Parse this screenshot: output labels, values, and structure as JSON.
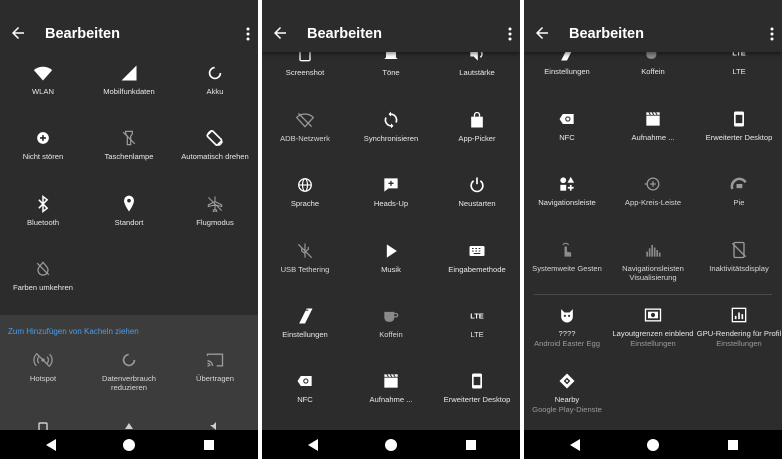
{
  "screens": [
    {
      "title": "Bearbeiten",
      "active_tiles": [
        {
          "label": "WLAN"
        },
        {
          "label": "Mobilfunkdaten"
        },
        {
          "label": "Akku"
        },
        {
          "label": "Nicht stören"
        },
        {
          "label": "Taschenlampe"
        },
        {
          "label": "Automatisch drehen"
        },
        {
          "label": "Bluetooth"
        },
        {
          "label": "Standort"
        },
        {
          "label": "Flugmodus"
        },
        {
          "label": "Farben umkehren"
        }
      ],
      "drag_hint": "Zum Hinzufügen von Kacheln ziehen",
      "available_tiles": [
        {
          "label": "Hotspot"
        },
        {
          "label": "Datenverbrauch",
          "label2": "reduzieren"
        },
        {
          "label": "Übertragen"
        }
      ]
    },
    {
      "title": "Bearbeiten",
      "tiles": [
        {
          "label": "Screenshot"
        },
        {
          "label": "Töne"
        },
        {
          "label": "Lautstärke"
        },
        {
          "label": "ADB-Netzwerk"
        },
        {
          "label": "Synchronisieren"
        },
        {
          "label": "App-Picker"
        },
        {
          "label": "Sprache"
        },
        {
          "label": "Heads-Up"
        },
        {
          "label": "Neustarten"
        },
        {
          "label": "USB Tethering"
        },
        {
          "label": "Musik"
        },
        {
          "label": "Eingabemethode"
        },
        {
          "label": "Einstellungen"
        },
        {
          "label": "Koffein"
        },
        {
          "label": "LTE"
        },
        {
          "label": "NFC"
        },
        {
          "label": "Aufnahme ..."
        },
        {
          "label": "Erweiterter Desktop"
        }
      ]
    },
    {
      "title": "Bearbeiten",
      "tiles": [
        {
          "label": "Einstellungen"
        },
        {
          "label": "Koffein"
        },
        {
          "label": "LTE"
        },
        {
          "label": "NFC"
        },
        {
          "label": "Aufnahme ..."
        },
        {
          "label": "Erweiterter Desktop"
        },
        {
          "label": "Navigationsleiste"
        },
        {
          "label": "App-Kreis-Leiste"
        },
        {
          "label": "Pie"
        },
        {
          "label": "Systemweite Gesten"
        },
        {
          "label": "Navigationsleisten",
          "label2": "Visualisierung"
        },
        {
          "label": "Inaktivitätsdisplay"
        },
        {
          "label": "????",
          "sub": "Android Easter Egg"
        },
        {
          "label": "Layoutgrenzen einblend",
          "sub": "Einstellungen"
        },
        {
          "label": "GPU-Rendering für Profil",
          "sub": "Einstellungen"
        },
        {
          "label": "Nearby",
          "sub": "Google Play-Dienste"
        }
      ]
    }
  ],
  "colors": {
    "background": "#2c2c2c",
    "available_panel": "#3c3c3c",
    "hint": "#4d9de8",
    "navbar": "#000000"
  }
}
